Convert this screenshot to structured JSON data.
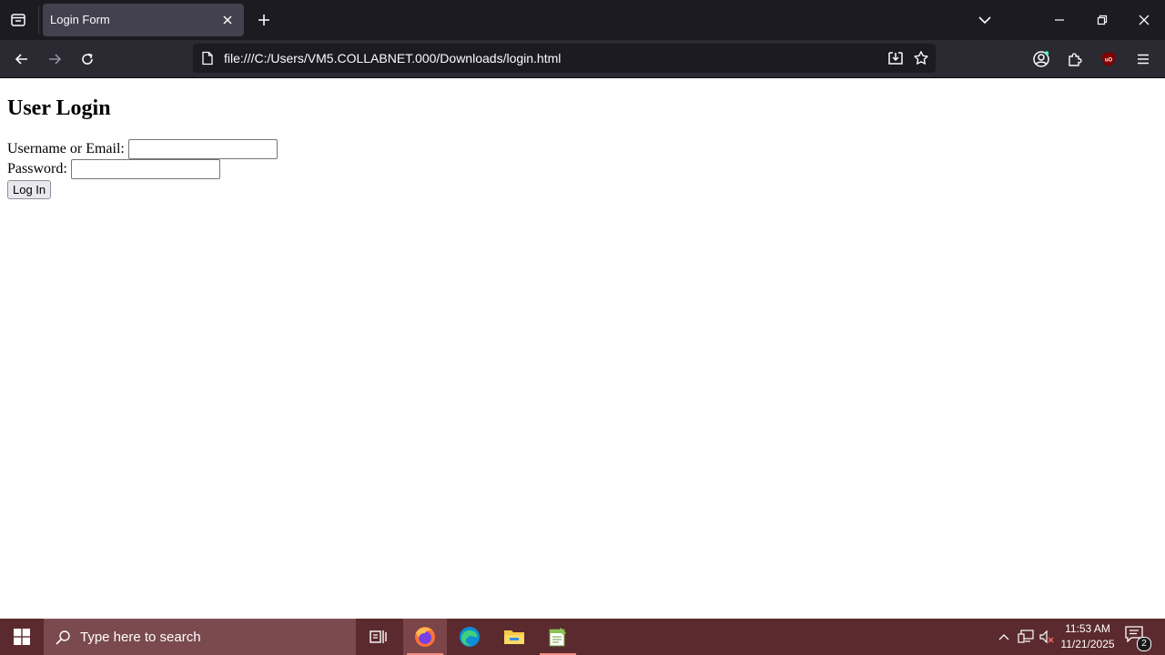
{
  "browser": {
    "tab": {
      "title": "Login Form"
    },
    "url": "file:///C:/Users/VM5.COLLABNET.000/Downloads/login.html"
  },
  "page": {
    "heading": "User Login",
    "username_label": "Username or Email:",
    "username_value": "",
    "password_label": "Password:",
    "password_value": "",
    "login_button": "Log In"
  },
  "taskbar": {
    "search_placeholder": "Type here to search",
    "clock_time": "11:53 AM",
    "clock_date": "11/21/2025",
    "notification_count": "2"
  },
  "colors": {
    "tabbar_bg": "#1c1b22",
    "navbar_bg": "#2b2a33",
    "active_tab": "#42414d",
    "taskbar_bg": "#5b2a2e"
  }
}
